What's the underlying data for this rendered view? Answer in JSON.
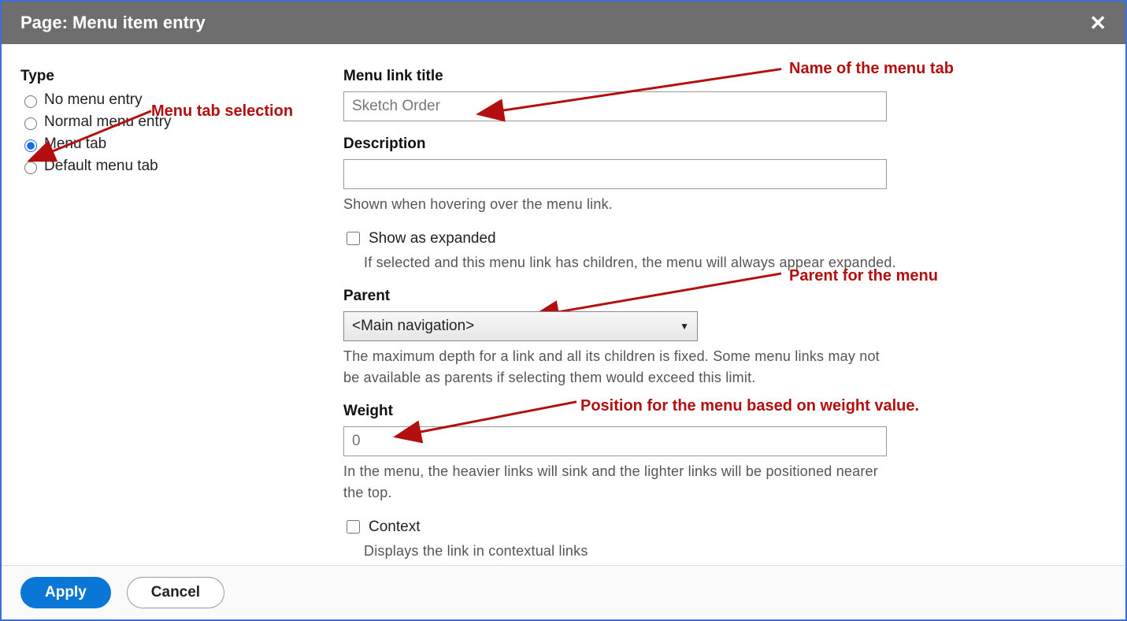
{
  "dialog": {
    "title": "Page: Menu item entry"
  },
  "type": {
    "label": "Type",
    "options": {
      "none": "No menu entry",
      "normal": "Normal menu entry",
      "tab": "Menu tab",
      "default_tab": "Default menu tab"
    },
    "selected": "tab"
  },
  "menu_link_title": {
    "label": "Menu link title",
    "value": "Sketch Order"
  },
  "description": {
    "label": "Description",
    "value": "",
    "help": "Shown when hovering over the menu link."
  },
  "expanded": {
    "label": "Show as expanded",
    "checked": false,
    "help": "If selected and this menu link has children, the menu will always appear expanded."
  },
  "parent": {
    "label": "Parent",
    "value": "<Main navigation>",
    "help": "The maximum depth for a link and all its children is fixed. Some menu links may not be available as parents if selecting them would exceed this limit."
  },
  "weight": {
    "label": "Weight",
    "value": "0",
    "help": "In the menu, the heavier links will sink and the lighter links will be positioned nearer the top."
  },
  "context": {
    "label": "Context",
    "checked": false,
    "help": "Displays the link in contextual links"
  },
  "buttons": {
    "apply": "Apply",
    "cancel": "Cancel"
  },
  "annotations": {
    "menu_tab_selection": "Menu tab selection",
    "name_of_tab": "Name of the menu tab",
    "parent_for_menu": "Parent for the menu",
    "position_weight": "Position for the menu based on weight value."
  }
}
